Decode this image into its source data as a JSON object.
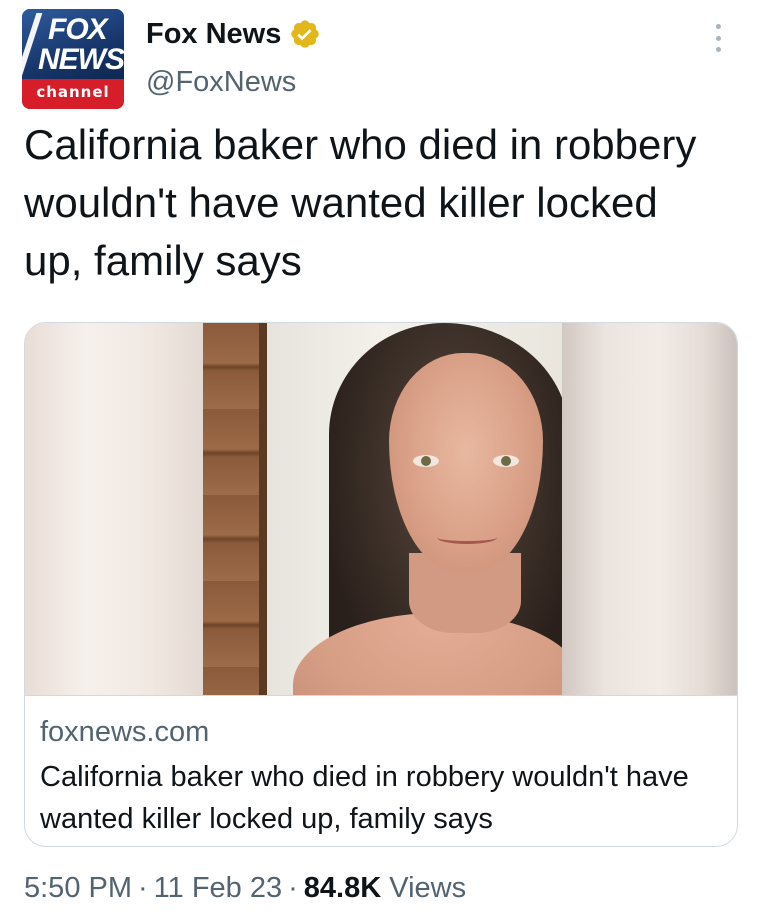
{
  "account": {
    "display_name": "Fox News",
    "handle": "@FoxNews",
    "verified": true,
    "verified_badge_color": "#e2b719",
    "avatar": {
      "logo_line1": "FOX",
      "logo_line2": "NEWS",
      "logo_line3": "channel",
      "brand_blue": "#1b3f7a",
      "brand_red": "#d61d2a"
    }
  },
  "more_menu_icon": "more-dots-icon",
  "tweet": {
    "text": "California baker who died in robbery wouldn't have wanted killer locked up, family says"
  },
  "card": {
    "image_description_icon": "photo",
    "domain": "foxnews.com",
    "title": "California baker who died in robbery wouldn't have wanted killer locked up, family says"
  },
  "meta": {
    "time": "5:50 PM",
    "separator": "·",
    "date": "11 Feb 23",
    "views_count": "84.8K",
    "views_label": "Views"
  }
}
